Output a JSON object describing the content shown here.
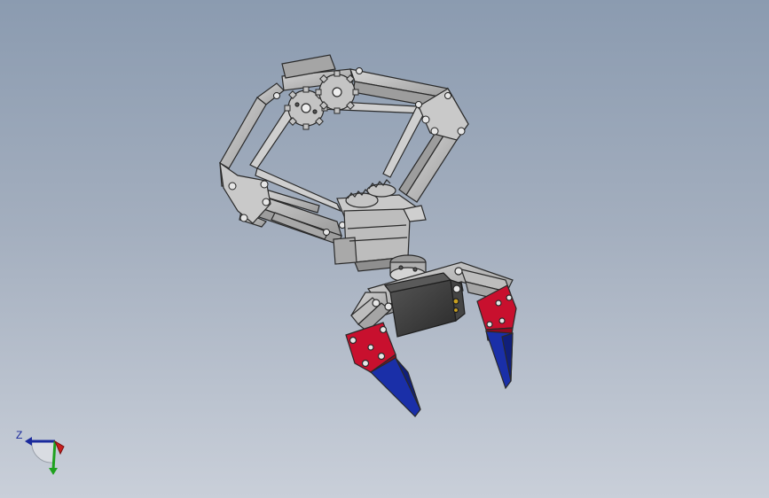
{
  "viewport": {
    "background_top": "#8b9bb0",
    "background_bottom": "#c9cfd9"
  },
  "model": {
    "part_gray": "#b8b8b8",
    "part_edge": "#2a2a2a",
    "gear_gray": "#c4c4c4",
    "servo_dark": "#3a3a3a",
    "servo_light": "#bfbfbf",
    "finger_red": "#c8102e",
    "finger_blue": "#1a2fa8"
  },
  "triad": {
    "z_label": "Z",
    "x_color": "#c81e1e",
    "y_color": "#1ea11e",
    "z_color": "#1b2a9c"
  }
}
